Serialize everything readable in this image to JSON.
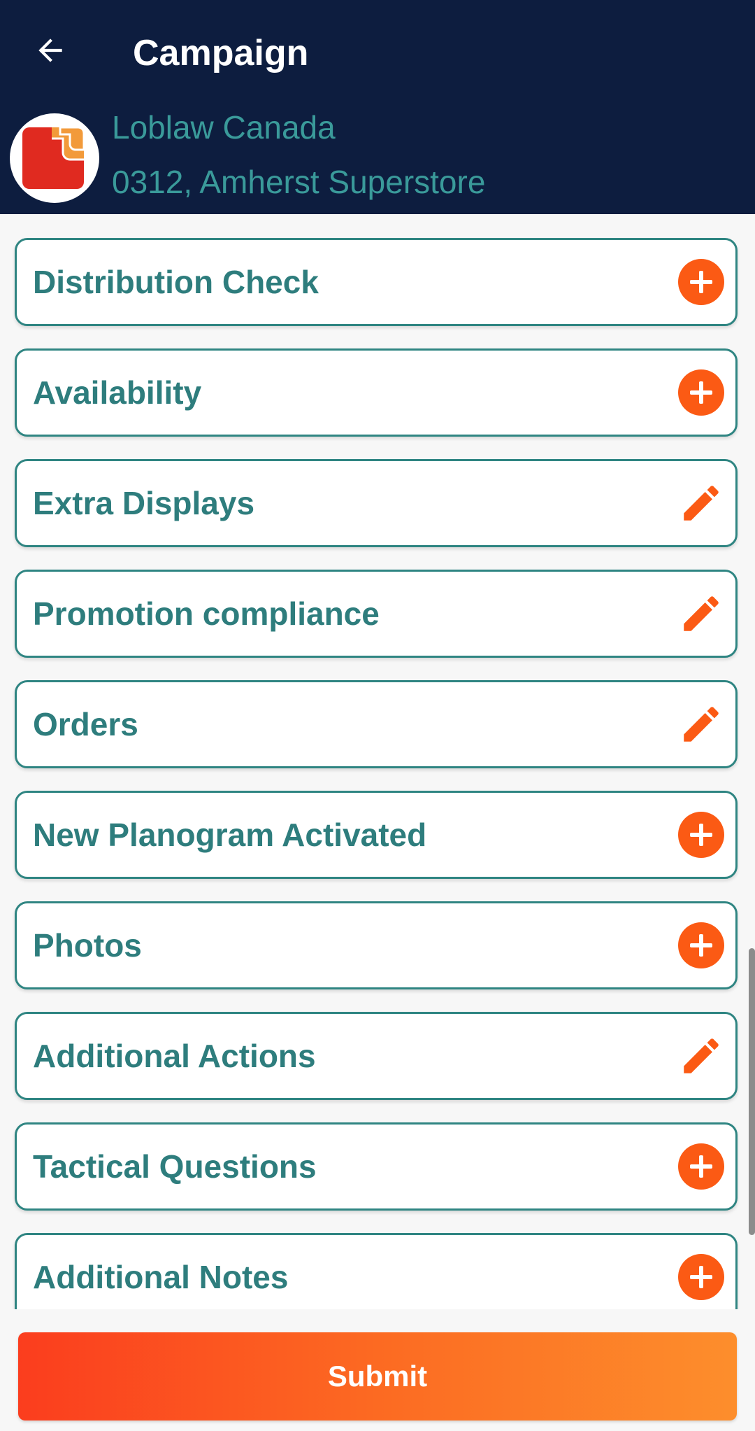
{
  "header": {
    "title": "Campaign",
    "back_icon": "arrow-left-icon",
    "background_color": "#0d1d3f"
  },
  "store": {
    "logo_icon": "store-logo",
    "name": "Loblaw Canada",
    "address": "0312, Amherst Superstore"
  },
  "sections": [
    {
      "label": "Distribution Check",
      "action": "add"
    },
    {
      "label": "Availability",
      "action": "add"
    },
    {
      "label": "Extra Displays",
      "action": "edit"
    },
    {
      "label": "Promotion compliance",
      "action": "edit"
    },
    {
      "label": "Orders",
      "action": "edit"
    },
    {
      "label": "New Planogram Activated",
      "action": "add"
    },
    {
      "label": "Photos",
      "action": "add"
    },
    {
      "label": "Additional Actions",
      "action": "edit"
    },
    {
      "label": "Tactical Questions",
      "action": "add"
    },
    {
      "label": "Additional Notes",
      "action": "add"
    }
  ],
  "footer": {
    "submit_label": "Submit"
  },
  "colors": {
    "accent": "#fb5a14",
    "teal_text": "#2e7d7d",
    "card_border": "#2f8582"
  }
}
